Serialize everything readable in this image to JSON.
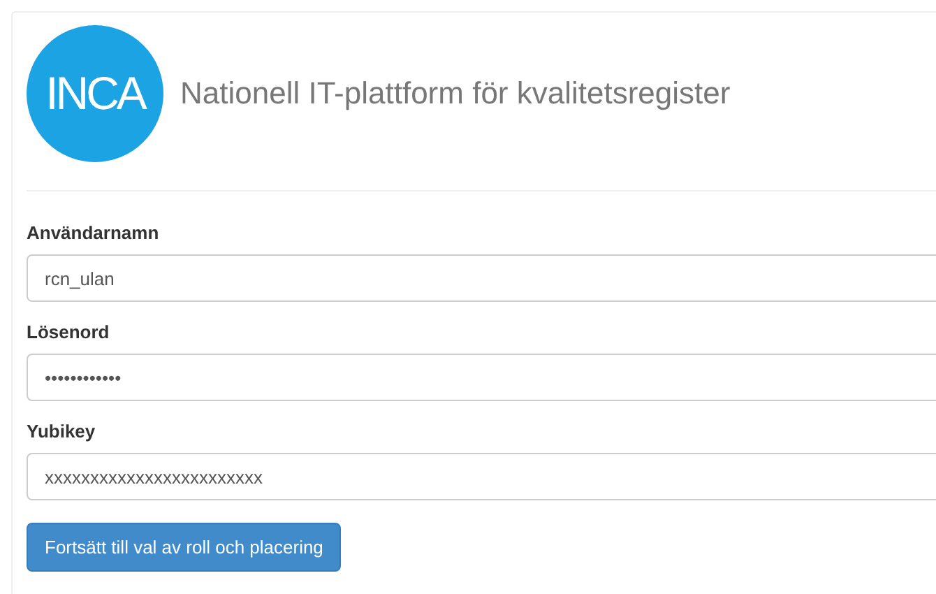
{
  "header": {
    "logo_text": "INCA",
    "title": "Nationell IT-plattform för kvalitetsregister"
  },
  "fields": [
    {
      "label": "Användarnamn",
      "value": "rcn_ulan"
    },
    {
      "label": "Lösenord",
      "value": "••••••••••••"
    },
    {
      "label": "Yubikey",
      "value": "xxxxxxxxxxxxxxxxxxxxxxxx"
    }
  ],
  "submit_button": "Fortsätt till val av roll och placering"
}
